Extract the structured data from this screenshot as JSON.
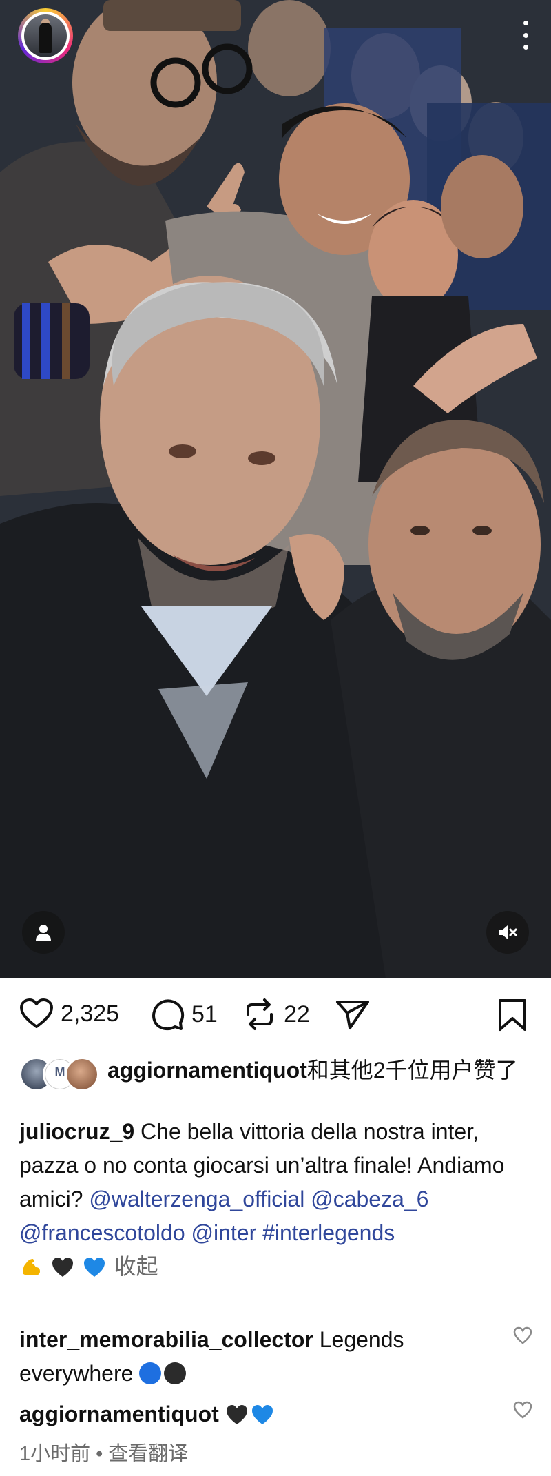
{
  "post": {
    "photo_alt": "",
    "likes_count": "2,325",
    "comments_count": "51",
    "reposts_count": "22"
  },
  "likes_line": {
    "user": "aggiornamentiquot",
    "rest": "和其他2千位用户赞了"
  },
  "caption": {
    "user": "juliocruz_9",
    "text": " Che bella vittoria della nostra inter, pazza o no conta giocarsi un’altra finale! Andiamo amici? ",
    "tags": [
      "@walterzenga_official",
      "@cabeza_6",
      "@francescotoldo",
      "@inter",
      "#interlegends"
    ],
    "collapse_label": "收起"
  },
  "comments": [
    {
      "user": "inter_memorabilia_collector",
      "text": " Legends everywhere "
    },
    {
      "user": "aggiornamentiquot",
      "text": ""
    }
  ],
  "meta": {
    "time": "1小时前",
    "translate": "查看翻译"
  },
  "icons": {
    "like": "heart-icon",
    "comment": "comment-bubble-icon",
    "repost": "repost-icon",
    "share": "paper-plane-icon",
    "save": "bookmark-icon",
    "more": "more-vertical-icon",
    "tag": "person-icon",
    "mute": "muted-speaker-icon"
  },
  "colors": {
    "tag_link": "#30479b",
    "meta_text": "#6b6b6b"
  }
}
